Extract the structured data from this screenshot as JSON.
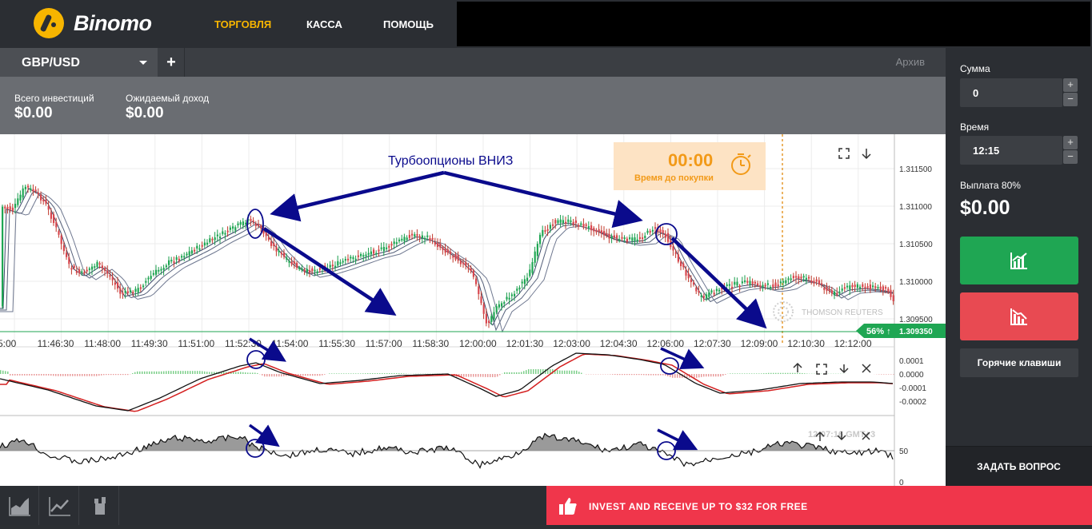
{
  "header": {
    "logo_text": "Binomo",
    "nav": [
      {
        "label": "ТОРГОВЛЯ",
        "active": true
      },
      {
        "label": "КАССА",
        "active": false
      },
      {
        "label": "ПОМОЩЬ",
        "active": false
      }
    ]
  },
  "tabs": {
    "pair": "GBP/USD",
    "add": "+",
    "archive": "Архив"
  },
  "info": {
    "invest_label": "Всего инвестиций",
    "invest_value": "$0.00",
    "income_label": "Ожидаемый доход",
    "income_value": "$0.00"
  },
  "chart": {
    "annotation": "Турбоопционы ВНИЗ",
    "timer_value": "00:00",
    "timer_label": "Время до покупки",
    "watermark": "THOMSON REUTERS",
    "price_badge_percent": "56% ↑",
    "price_badge_value": "1.309350",
    "clock_text": "12:07:16 GMT+3",
    "y_ticks": [
      "1.311500",
      "1.311000",
      "1.310500",
      "1.310000",
      "1.309500"
    ],
    "x_ticks": [
      "5:00",
      "11:46:30",
      "11:48:00",
      "11:49:30",
      "11:51:00",
      "11:52:30",
      "11:54:00",
      "11:55:30",
      "11:57:00",
      "11:58:30",
      "12:00:00",
      "12:01:30",
      "12:03:00",
      "12:04:30",
      "12:06:00",
      "12:07:30",
      "12:09:00",
      "12:10:30",
      "12:12:00"
    ],
    "macd_ticks": [
      "0.0001",
      "0.0000",
      "-0.0001",
      "-0.0002"
    ],
    "osc_ticks": [
      "50",
      "0"
    ]
  },
  "sidebar": {
    "amount_label": "Сумма",
    "amount_value": "0",
    "time_label": "Время",
    "time_value": "12:15",
    "payout_label": "Выплата 80%",
    "payout_value": "$0.00",
    "hotkeys": "Горячие клавиши",
    "ask": "ЗАДАТЬ ВОПРОС",
    "step_plus": "+",
    "step_minus": "−"
  },
  "bottom": {
    "promo": "INVEST AND RECEIVE UP TO $32 FOR FREE"
  },
  "colors": {
    "accent": "#f7b500",
    "up": "#1fa653",
    "down": "#e84a52",
    "promo": "#f0364b",
    "annotation": "#0a0a8c"
  }
}
